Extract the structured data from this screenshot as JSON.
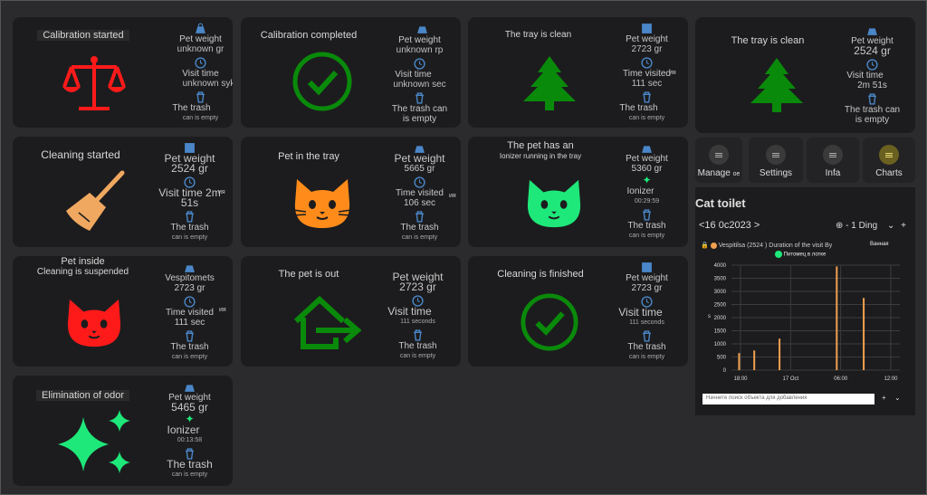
{
  "cards": [
    {
      "title": "Calibration started",
      "weight_label": "Pet weight",
      "weight_value": "unknown gr",
      "visit_label": "Visit time",
      "visit_value": "unknown syk",
      "trash_label": "The trash",
      "trash_value": "can is empty"
    },
    {
      "title": "Calibration completed",
      "weight_label": "Pet weight",
      "weight_value": "unknown rp",
      "visit_label": "Visit time",
      "visit_value": "unknown sec",
      "trash_label": "The trash can",
      "trash_value": "is empty"
    },
    {
      "title": "The tray is clean",
      "weight_label": "Pet weight",
      "weight_value": "2723 gr",
      "visit_label": "Time visited",
      "visit_value": "111 sec",
      "visit_suffix": "ия",
      "trash_label": "The trash",
      "trash_value": "can is empty"
    },
    {
      "title": "Cleaning started",
      "weight_label": "Pet weight",
      "weight_value": "2524 gr",
      "visit_label": "Visit time 2m",
      "visit_value": "51s",
      "visit_suffix": "ия",
      "trash_label": "The trash",
      "trash_value": "can is empty"
    },
    {
      "title": "Pet in the tray",
      "weight_label": "Pet weight",
      "weight_value": "5665 gr",
      "visit_label": "Time visited",
      "visit_value": "106 sec",
      "visit_suffix": "ия",
      "trash_label": "The trash",
      "trash_value": "can is empty"
    },
    {
      "title": "The pet has an",
      "title2": "Ionizer running in the tray",
      "weight_label": "Pet weight",
      "weight_value": "5360 gr",
      "visit_label": "Ionizer",
      "visit_value": "00:29:59",
      "trash_label": "The trash",
      "trash_value": "can is empty"
    },
    {
      "title": "Pet inside",
      "title2": "Cleaning is suspended",
      "weight_label": "Vespitomets",
      "weight_value": "2723 gr",
      "visit_label": "Time visited",
      "visit_value": "111 sec",
      "visit_suffix": "ия",
      "trash_label": "The trash",
      "trash_value": "can is empty"
    },
    {
      "title": "The pet is out",
      "weight_label": "Pet weight",
      "weight_value": "2723 gr",
      "visit_label": "Visit time",
      "visit_value": "111 seconds",
      "trash_label": "The trash",
      "trash_value": "can is empty"
    },
    {
      "title": "Cleaning is finished",
      "weight_label": "Pet weight",
      "weight_value": "2723 gr",
      "visit_label": "Visit time",
      "visit_value": "111 seconds",
      "trash_label": "The trash",
      "trash_value": "can is empty"
    },
    {
      "title": "Elimination of odor",
      "weight_label": "Pet weight",
      "weight_value": "5465 gr",
      "visit_label": "Ionizer",
      "visit_value": "00:13:58",
      "trash_label": "The trash",
      "trash_value": "can is empty"
    }
  ],
  "summary": {
    "title": "The tray is clean",
    "weight_label": "Pet weight",
    "weight_value": "2524 gr",
    "visit_label": "Visit time",
    "visit_value": "2m 51s",
    "trash_label": "The trash can",
    "trash_value": "is empty"
  },
  "nav": [
    {
      "label": "Manage",
      "suffix": "ое"
    },
    {
      "label": "Settings"
    },
    {
      "label": "Infa"
    },
    {
      "label": "Charts"
    }
  ],
  "colors": {
    "accent": "#c9b84a",
    "red": "#ff1a1a",
    "green": "#0a8a0a",
    "orange": "#ff8c1a",
    "mint": "#1ee87a",
    "bar": "#f0a050"
  },
  "chart_panel": {
    "title": "Cat toilet",
    "date_range": "<16 0c2023 >",
    "zoom_label": "- 1 Ding",
    "caption": "Vespitilsa (2524 ) Duration of the visit By",
    "caption_right": "Ванная",
    "legend": "Питомец в лотке",
    "input_placeholder": "Начните поиск объекта для добавления"
  },
  "chart_data": {
    "type": "bar",
    "x_ticks": [
      "18:00",
      "17 Oct",
      "06:00",
      "12:00"
    ],
    "ylim": [
      0,
      4000
    ],
    "y_ticks": [
      0,
      500,
      1000,
      1500,
      2000,
      2500,
      3000,
      3500,
      4000
    ],
    "ylabel": "s",
    "series": [
      {
        "name": "Питомец в лотке",
        "points": [
          [
            0.04,
            650
          ],
          [
            0.13,
            750
          ],
          [
            0.28,
            1200
          ],
          [
            0.62,
            3950
          ],
          [
            0.78,
            2750
          ]
        ]
      }
    ]
  }
}
